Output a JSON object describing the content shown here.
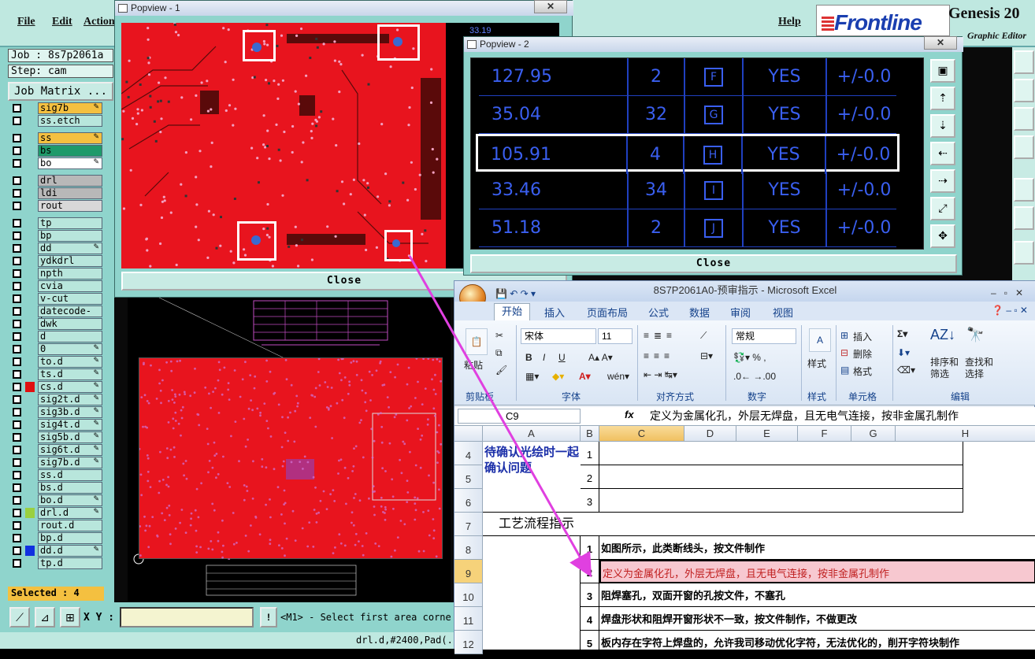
{
  "genesis": {
    "menu": [
      "File",
      "Edit",
      "Action",
      "Help"
    ],
    "logo_text": "Frontline",
    "app_title": "Genesis 20",
    "subtitle": "Graphic Editor",
    "job": "Job : 8s7p2061a",
    "step": "Step: cam",
    "job_matrix": "Job Matrix ...",
    "selected": "Selected : 4",
    "xy_label": "X Y :",
    "prompt": "<M1> - Select first area corne",
    "status": "drl.d,#2400,Pad(..."
  },
  "layers": [
    {
      "name": "sig7b",
      "color": "#f4c040",
      "edit": true
    },
    {
      "name": "ss.etch",
      "color": "",
      "edit": false
    },
    {
      "name": "ss",
      "color": "#f4c040",
      "edit": true
    },
    {
      "name": "bs",
      "color": "#1e9a6a",
      "edit": false
    },
    {
      "name": "bo",
      "color": "#ffffff",
      "edit": true
    },
    {
      "name": "drl",
      "color": "#b8b8b8",
      "edit": false
    },
    {
      "name": "ldi",
      "color": "#b8b8b8",
      "edit": false
    },
    {
      "name": "rout",
      "color": "#d8d8d8",
      "edit": false
    },
    {
      "name": "tp",
      "color": "",
      "edit": false
    },
    {
      "name": "bp",
      "color": "",
      "edit": false
    },
    {
      "name": "dd",
      "color": "",
      "edit": true
    },
    {
      "name": "ydkdrl",
      "color": "",
      "edit": false
    },
    {
      "name": "npth",
      "color": "",
      "edit": false
    },
    {
      "name": "cvia",
      "color": "",
      "edit": false
    },
    {
      "name": "v-cut",
      "color": "",
      "edit": false
    },
    {
      "name": "datecode-bo",
      "color": "",
      "edit": false
    },
    {
      "name": "dwk",
      "color": "",
      "edit": false
    },
    {
      "name": "d",
      "color": "",
      "edit": false
    },
    {
      "name": "0",
      "color": "",
      "edit": true
    },
    {
      "name": "to.d",
      "color": "",
      "edit": true
    },
    {
      "name": "ts.d",
      "color": "",
      "edit": true
    },
    {
      "name": "cs.d",
      "color": "",
      "edit": true,
      "swatch": "#e01010"
    },
    {
      "name": "sig2t.d",
      "color": "",
      "edit": true
    },
    {
      "name": "sig3b.d",
      "color": "",
      "edit": true
    },
    {
      "name": "sig4t.d",
      "color": "",
      "edit": true
    },
    {
      "name": "sig5b.d",
      "color": "",
      "edit": true
    },
    {
      "name": "sig6t.d",
      "color": "",
      "edit": true
    },
    {
      "name": "sig7b.d",
      "color": "",
      "edit": true
    },
    {
      "name": "ss.d",
      "color": "",
      "edit": false
    },
    {
      "name": "bs.d",
      "color": "",
      "edit": false
    },
    {
      "name": "bo.d",
      "color": "",
      "edit": true
    },
    {
      "name": "drl.d",
      "color": "",
      "edit": true,
      "swatch": "#9ad040"
    },
    {
      "name": "rout.d",
      "color": "",
      "edit": false
    },
    {
      "name": "bp.d",
      "color": "",
      "edit": false
    },
    {
      "name": "dd.d",
      "color": "",
      "edit": true,
      "swatch": "#1030e0"
    },
    {
      "name": "tp.d",
      "color": "",
      "edit": false
    }
  ],
  "popview1": {
    "title": "Popview - 1",
    "close": "Close",
    "coord": "33.19"
  },
  "popview2": {
    "title": "Popview - 2",
    "close": "Close",
    "rows": [
      {
        "size": "127.95",
        "count": "2",
        "sym": "F",
        "plated": "YES",
        "tol": "+/-0.0"
      },
      {
        "size": "35.04",
        "count": "32",
        "sym": "G",
        "plated": "YES",
        "tol": "+/-0.0"
      },
      {
        "size": "105.91",
        "count": "4",
        "sym": "H",
        "plated": "YES",
        "tol": "+/-0.0"
      },
      {
        "size": "33.46",
        "count": "34",
        "sym": "I",
        "plated": "YES",
        "tol": "+/-0.0"
      },
      {
        "size": "51.18",
        "count": "2",
        "sym": "J",
        "plated": "YES",
        "tol": "+/-0.0"
      }
    ],
    "highlighted_row": 2
  },
  "excel": {
    "title": "8S7P2061A0-预审指示 - Microsoft Excel",
    "tabs": [
      "开始",
      "插入",
      "页面布局",
      "公式",
      "数据",
      "审阅",
      "视图"
    ],
    "font_name": "宋体",
    "font_size": "11",
    "number_format": "常规",
    "groups": [
      "剪贴板",
      "字体",
      "对齐方式",
      "数字",
      "样式",
      "单元格",
      "编辑"
    ],
    "paste": "粘贴",
    "style": "样式",
    "insert": "插入",
    "delete": "删除",
    "format": "格式",
    "sort_filter": "排序和\n筛选",
    "find_select": "查找和\n选择",
    "name_box": "C9",
    "fx": "fx",
    "formula": "定义为金属化孔，外层无焊盘，且无电气连接，按非金属孔制作",
    "columns": [
      "A",
      "B",
      "C",
      "D",
      "E",
      "F",
      "G",
      "H"
    ],
    "section1_label": "待确认光绘时一起确认问题",
    "section2_label": "工艺流程指示",
    "rows": [
      {
        "row": "4",
        "b": "1",
        "c": ""
      },
      {
        "row": "5",
        "b": "2",
        "c": ""
      },
      {
        "row": "6",
        "b": "3",
        "c": ""
      },
      {
        "row": "7",
        "b": "",
        "c": ""
      },
      {
        "row": "8",
        "b": "1",
        "c": "如图所示，此类断线头，按文件制作"
      },
      {
        "row": "9",
        "b": "2",
        "c": "定义为金属化孔，外层无焊盘，且无电气连接，按非金属孔制作"
      },
      {
        "row": "10",
        "b": "3",
        "c": "阻焊塞孔，双面开窗的孔按文件，不塞孔"
      },
      {
        "row": "11",
        "b": "4",
        "c": "焊盘形状和阻焊开窗形状不一致，按文件制作，不做更改"
      },
      {
        "row": "12",
        "b": "5",
        "c": "板内存在字符上焊盘的，允许我司移动优化字符，无法优化的，削开字符块制作"
      }
    ]
  }
}
